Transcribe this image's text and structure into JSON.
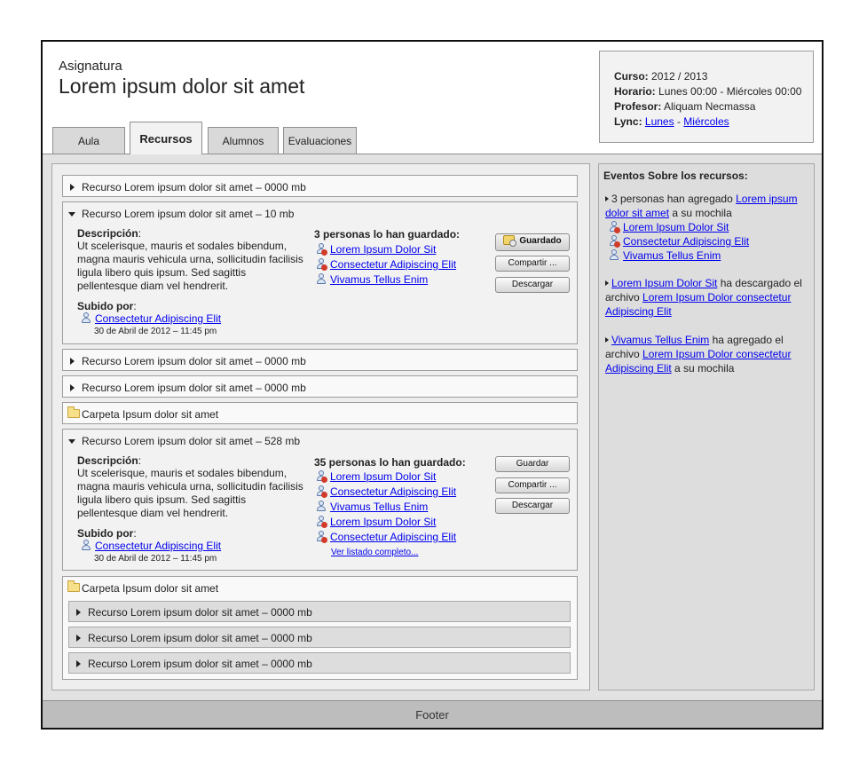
{
  "header": {
    "label": "Asignatura",
    "title": "Lorem ipsum dolor sit amet"
  },
  "info": {
    "curso_label": "Curso:",
    "curso_value": "2012 / 2013",
    "horario_label": "Horario:",
    "horario_value": "Lunes 00:00 - Miércoles 00:00",
    "profesor_label": "Profesor:",
    "profesor_value": "Aliquam Necmassa",
    "lync_label": "Lync:",
    "lync_link1": "Lunes",
    "lync_sep": "-",
    "lync_link2": "Miércoles"
  },
  "tabs": [
    "Aula",
    "Recursos",
    "Alumnos",
    "Evaluaciones"
  ],
  "resources": {
    "r1": "Recurso Lorem ipsum dolor sit amet – 0000 mb",
    "r2": "Recurso Lorem ipsum dolor sit amet – 10 mb",
    "r3": "Recurso Lorem ipsum dolor sit amet – 0000 mb",
    "r4": "Recurso Lorem ipsum dolor sit amet – 0000 mb",
    "folder1": "Carpeta Ipsum dolor sit amet",
    "r5": "Recurso Lorem ipsum dolor sit amet – 528 mb",
    "folder2": "Carpeta Ipsum dolor sit amet",
    "sub1": "Recurso Lorem ipsum dolor sit amet – 0000 mb",
    "sub2": "Recurso Lorem ipsum dolor sit amet – 0000 mb",
    "sub3": "Recurso Lorem ipsum dolor sit amet – 0000 mb"
  },
  "detail1": {
    "desc_label": "Descripción",
    "desc_colon": ":",
    "desc_text": "Ut scelerisque, mauris et sodales bibendum, magna mauris vehicula urna, sollicitudin facilisis ligula libero quis ipsum. Sed sagittis pellentesque diam vel hendrerit.",
    "uploaded_label": "Subido por",
    "uploaded_colon": ":",
    "uploader": "Consectetur Adipiscing Elit",
    "date": "30 de Abril de 2012 – 11:45 pm",
    "saved_by": "3 personas lo han guardado:",
    "users": [
      "Lorem Ipsum Dolor Sit",
      "Consectetur Adipiscing Elit",
      "Vivamus Tellus Enim"
    ],
    "btn_saved": "Guardado",
    "btn_share": "Compartir ...",
    "btn_download": "Descargar"
  },
  "detail2": {
    "desc_label": "Descripción",
    "desc_colon": ":",
    "desc_text": "Ut scelerisque, mauris et sodales bibendum, magna mauris vehicula urna, sollicitudin facilisis ligula libero quis ipsum. Sed sagittis pellentesque diam vel hendrerit.",
    "uploaded_label": "Subido por",
    "uploaded_colon": ":",
    "uploader": "Consectetur Adipiscing Elit",
    "date": "30 de Abril de 2012 – 11:45 pm",
    "saved_by": "35 personas lo han guardado:",
    "users": [
      "Lorem Ipsum Dolor Sit",
      "Consectetur Adipiscing Elit",
      "Vivamus Tellus Enim",
      "Lorem Ipsum Dolor Sit",
      "Consectetur Adipiscing Elit"
    ],
    "see_all": "Ver listado completo...",
    "btn_save": "Guardar",
    "btn_share": "Compartir ...",
    "btn_download": "Descargar"
  },
  "events": {
    "title": "Eventos Sobre los recursos:",
    "e1_text": "3 personas han agregado",
    "e1_link": "Lorem ipsum dolor sit amet",
    "e1_tail": "a su mochila",
    "e1_users": [
      "Lorem Ipsum Dolor Sit",
      "Consectetur Adipiscing Elit",
      "Vivamus Tellus Enim"
    ],
    "e2_link": "Lorem Ipsum Dolor Sit",
    "e2_text": "ha descargado el archivo",
    "e2_link2": "Lorem Ipsum Dolor consectetur Adipiscing Elit",
    "e3_link": "Vivamus Tellus Enim",
    "e3_text": "ha agregado el archivo",
    "e3_link2": "Lorem Ipsum Dolor consectetur Adipiscing Elit",
    "e3_tail": "a su mochila"
  },
  "footer": "Footer",
  "icons": {
    "expand_collapsed": "triangle-right-icon",
    "expand_open": "triangle-down-icon",
    "folder": "folder-icon",
    "user": "user-icon",
    "saved": "backpack-icon"
  }
}
